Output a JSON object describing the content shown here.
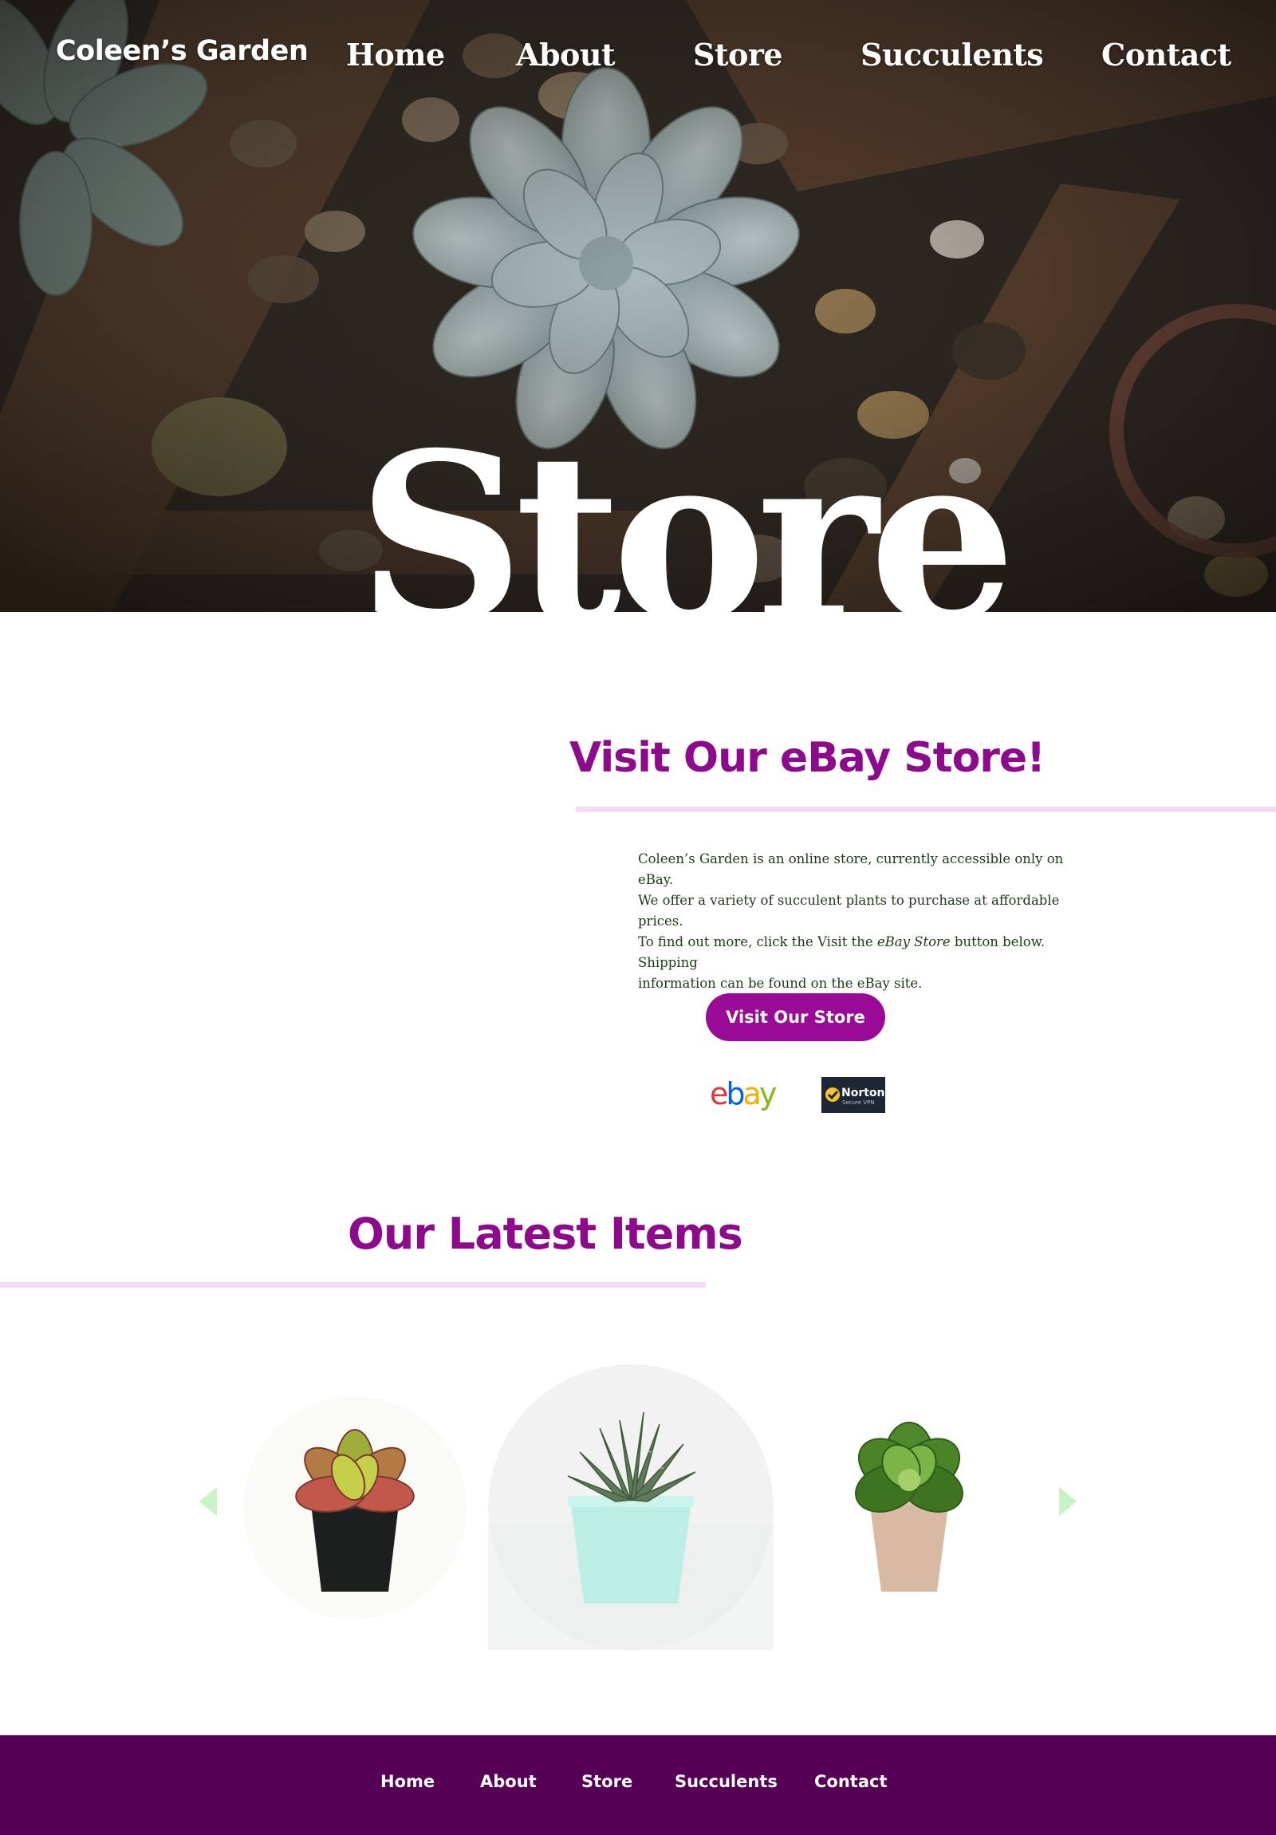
{
  "header": {
    "brand": "Coleen’s Garden",
    "nav": [
      "Home",
      "About",
      "Store",
      "Succulents",
      "Contact"
    ]
  },
  "hero": {
    "title": "Store"
  },
  "ebay_section": {
    "heading": "Visit Our eBay Store!",
    "paragraph_lines": [
      "Coleen’s Garden is an online store, currently accessible only on eBay.",
      "We offer a variety of succulent plants to purchase at affordable prices."
    ],
    "line3_before": "To find out more, click the Visit the ",
    "line3_emphasis": "eBay Store",
    "line3_after": " button below. Shipping",
    "line4": "information can be found on the eBay site.",
    "button_label": "Visit Our Store",
    "ebay_logo_text": "ebay",
    "norton_logo_text": "Norton",
    "norton_logo_subtext": "Secure VPN"
  },
  "latest_section": {
    "heading": "Our Latest Items",
    "carousel_items": [
      "red-tipped succulent in black pot",
      "zebra haworthia in mint pot",
      "green succulent in terracotta pot"
    ]
  },
  "footer": {
    "nav": [
      "Home",
      "About",
      "Store",
      "Succulents",
      "Contact"
    ]
  },
  "colors": {
    "accent": "#990b97",
    "heading": "#8e0a8c",
    "rule": "#f6d9f5",
    "body_text": "#1a3d14",
    "footer_bg": "#550054",
    "arrow": "#c9f2c6"
  },
  "icons": {
    "carousel_prev": "triangle-left-icon",
    "carousel_next": "triangle-right-icon"
  }
}
